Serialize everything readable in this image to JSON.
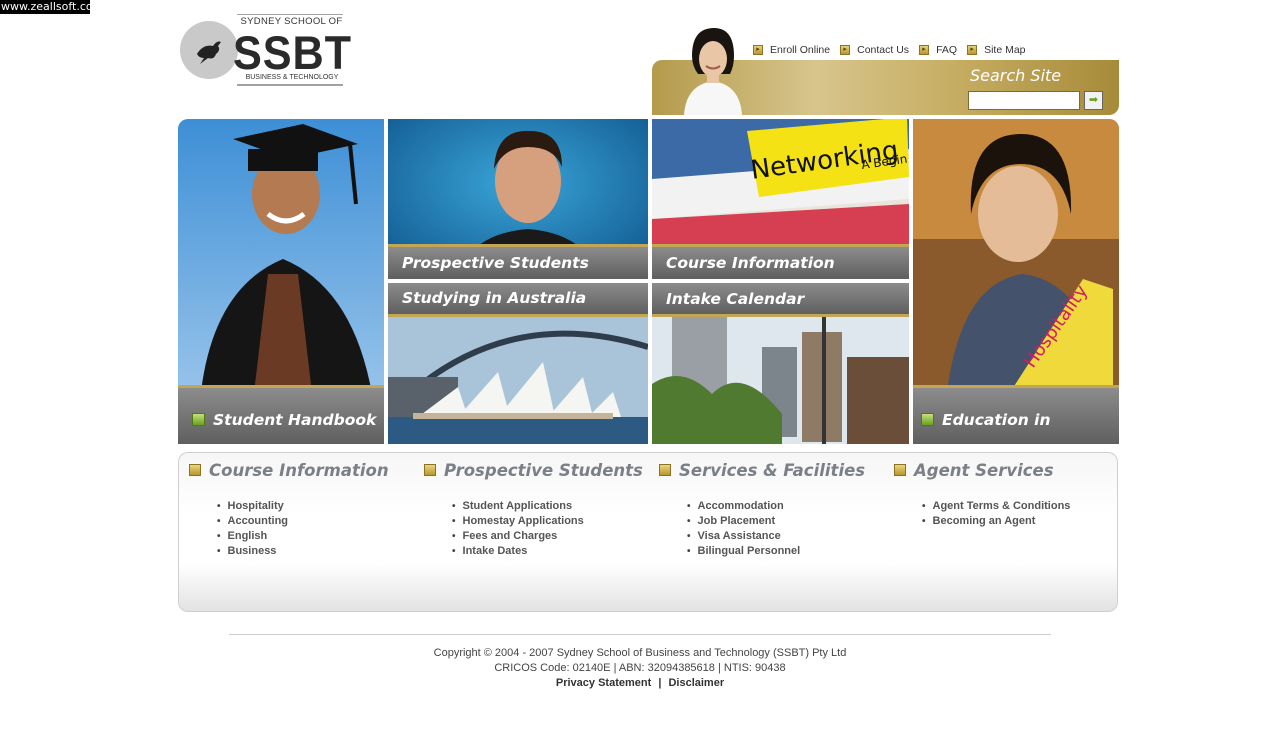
{
  "watermark": "www.zeallsoft.com",
  "logo": {
    "school_line": "SYDNEY SCHOOL OF",
    "name": "SSBT",
    "tagline": "BUSINESS & TECHNOLOGY"
  },
  "top_nav": [
    {
      "label": "Enroll Online"
    },
    {
      "label": "Contact Us"
    },
    {
      "label": "FAQ"
    },
    {
      "label": "Site Map"
    }
  ],
  "search": {
    "label": "Search Site",
    "value": "",
    "button_icon": "arrow-right-icon"
  },
  "tiles": {
    "student_handbook": "Student Handbook",
    "prospective_students": "Prospective Students",
    "course_information": "Course Information",
    "studying_in_australia": "Studying in Australia",
    "intake_calendar": "Intake Calendar",
    "education_in_australia": "Education in Australia",
    "networking_book_title": "Networking",
    "networking_book_sub": "A Begin",
    "hospitality_book": "Hospitality"
  },
  "sections": [
    {
      "title": "Course Information",
      "items": [
        "Hospitality",
        "Accounting",
        "English",
        "Business"
      ]
    },
    {
      "title": "Prospective Students",
      "items": [
        "Student Applications",
        "Homestay Applications",
        "Fees and Charges",
        "Intake Dates"
      ]
    },
    {
      "title": "Services & Facilities",
      "items": [
        "Accommodation",
        "Job Placement",
        "Visa Assistance",
        "Bilingual Personnel"
      ]
    },
    {
      "title": "Agent Services",
      "items": [
        "Agent Terms & Conditions",
        "Becoming an Agent"
      ]
    }
  ],
  "footer": {
    "copyright": "Copyright © 2004 - 2007 Sydney School of Business and Technology (SSBT) Pty Ltd",
    "codes": "CRICOS Code: 02140E | ABN: 32094385618 | NTIS: 90438",
    "privacy": "Privacy Statement",
    "separator": "|",
    "disclaimer": "Disclaimer"
  },
  "colors": {
    "gold": "#c2a654",
    "caption_grey": "#6f6f6f",
    "heading_grey": "#7b8087"
  }
}
